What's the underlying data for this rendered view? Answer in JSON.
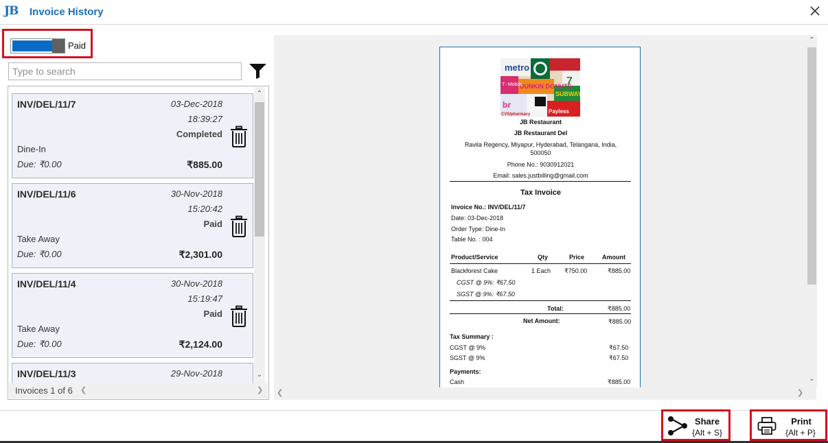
{
  "window": {
    "logo_text": "JB",
    "title": "Invoice History"
  },
  "toggle": {
    "label": "Paid",
    "state": "on"
  },
  "search": {
    "placeholder": "Type to search",
    "value": ""
  },
  "invoices": [
    {
      "number": "INV/DEL/11/7",
      "date": "03-Dec-2018",
      "time": "18:39:27",
      "status": "Completed",
      "order_type": "Dine-In",
      "due": "Due: ₹0.00",
      "amount": "₹885.00"
    },
    {
      "number": "INV/DEL/11/6",
      "date": "30-Nov-2018",
      "time": "15:20:42",
      "status": "Paid",
      "order_type": "Take Away",
      "due": "Due: ₹0.00",
      "amount": "₹2,301.00"
    },
    {
      "number": "INV/DEL/11/4",
      "date": "30-Nov-2018",
      "time": "15:19:47",
      "status": "Paid",
      "order_type": "Take Away",
      "due": "Due: ₹0.00",
      "amount": "₹2,124.00"
    },
    {
      "number": "INV/DEL/11/3",
      "date": "29-Nov-2018",
      "time": "",
      "status": "",
      "order_type": "",
      "due": "",
      "amount": ""
    }
  ],
  "list_footer": {
    "count_text": "Invoices 1 of 6"
  },
  "receipt": {
    "logo_words": [
      "metro",
      "DUNKIN DONUTS",
      "SUBWAY",
      "T··Mobile",
      "br",
      "CVS/pharmacy",
      "Payless",
      "7"
    ],
    "store_name": "JB Restaurant",
    "branch": "JB Restaurant Del",
    "address": "Ravila Regency, Miyapur, Hyderabad, Telangana, India, 500050",
    "phone": "Phone No.: 9030912021",
    "email": "Email: sales.justbilling@gmail.com",
    "title": "Tax Invoice",
    "invoice_no": "Invoice No.: INV/DEL/11/7",
    "date": "Date: 03-Dec-2018",
    "order_type": "Order Type: Dine-In",
    "table_no": "Table No. : 004",
    "columns": [
      "Product/Service",
      "Qty",
      "Price",
      "Amount"
    ],
    "item": {
      "name": "Blackforest Cake",
      "qty": "1 Each",
      "price": "₹750.00",
      "amount": "₹885.00"
    },
    "item_taxes": [
      "CGST @ 9%: ₹67.50",
      "SGST @ 9%: ₹67.50"
    ],
    "total_label": "Total:",
    "total_value": "₹885.00",
    "net_label": "Net Amount:",
    "net_value": "₹885.00",
    "tax_summary_title": "Tax Summary :",
    "tax_summary": [
      {
        "label": "CGST @ 9%",
        "value": "₹67.50"
      },
      {
        "label": "SGST @ 9%",
        "value": "₹67.50"
      }
    ],
    "payments_title": "Payments:",
    "payments": [
      {
        "label": "Cash",
        "value": "₹885.00"
      }
    ]
  },
  "buttons": {
    "share": {
      "label": "Share",
      "shortcut": "{Alt + S}"
    },
    "print": {
      "label": "Print",
      "shortcut": "{Alt + P}"
    }
  },
  "colors": {
    "accent": "#1b6fb8",
    "highlight": "#d4111d",
    "toggle_on": "#0a6bc4",
    "card_bg": "#eef2f8"
  }
}
